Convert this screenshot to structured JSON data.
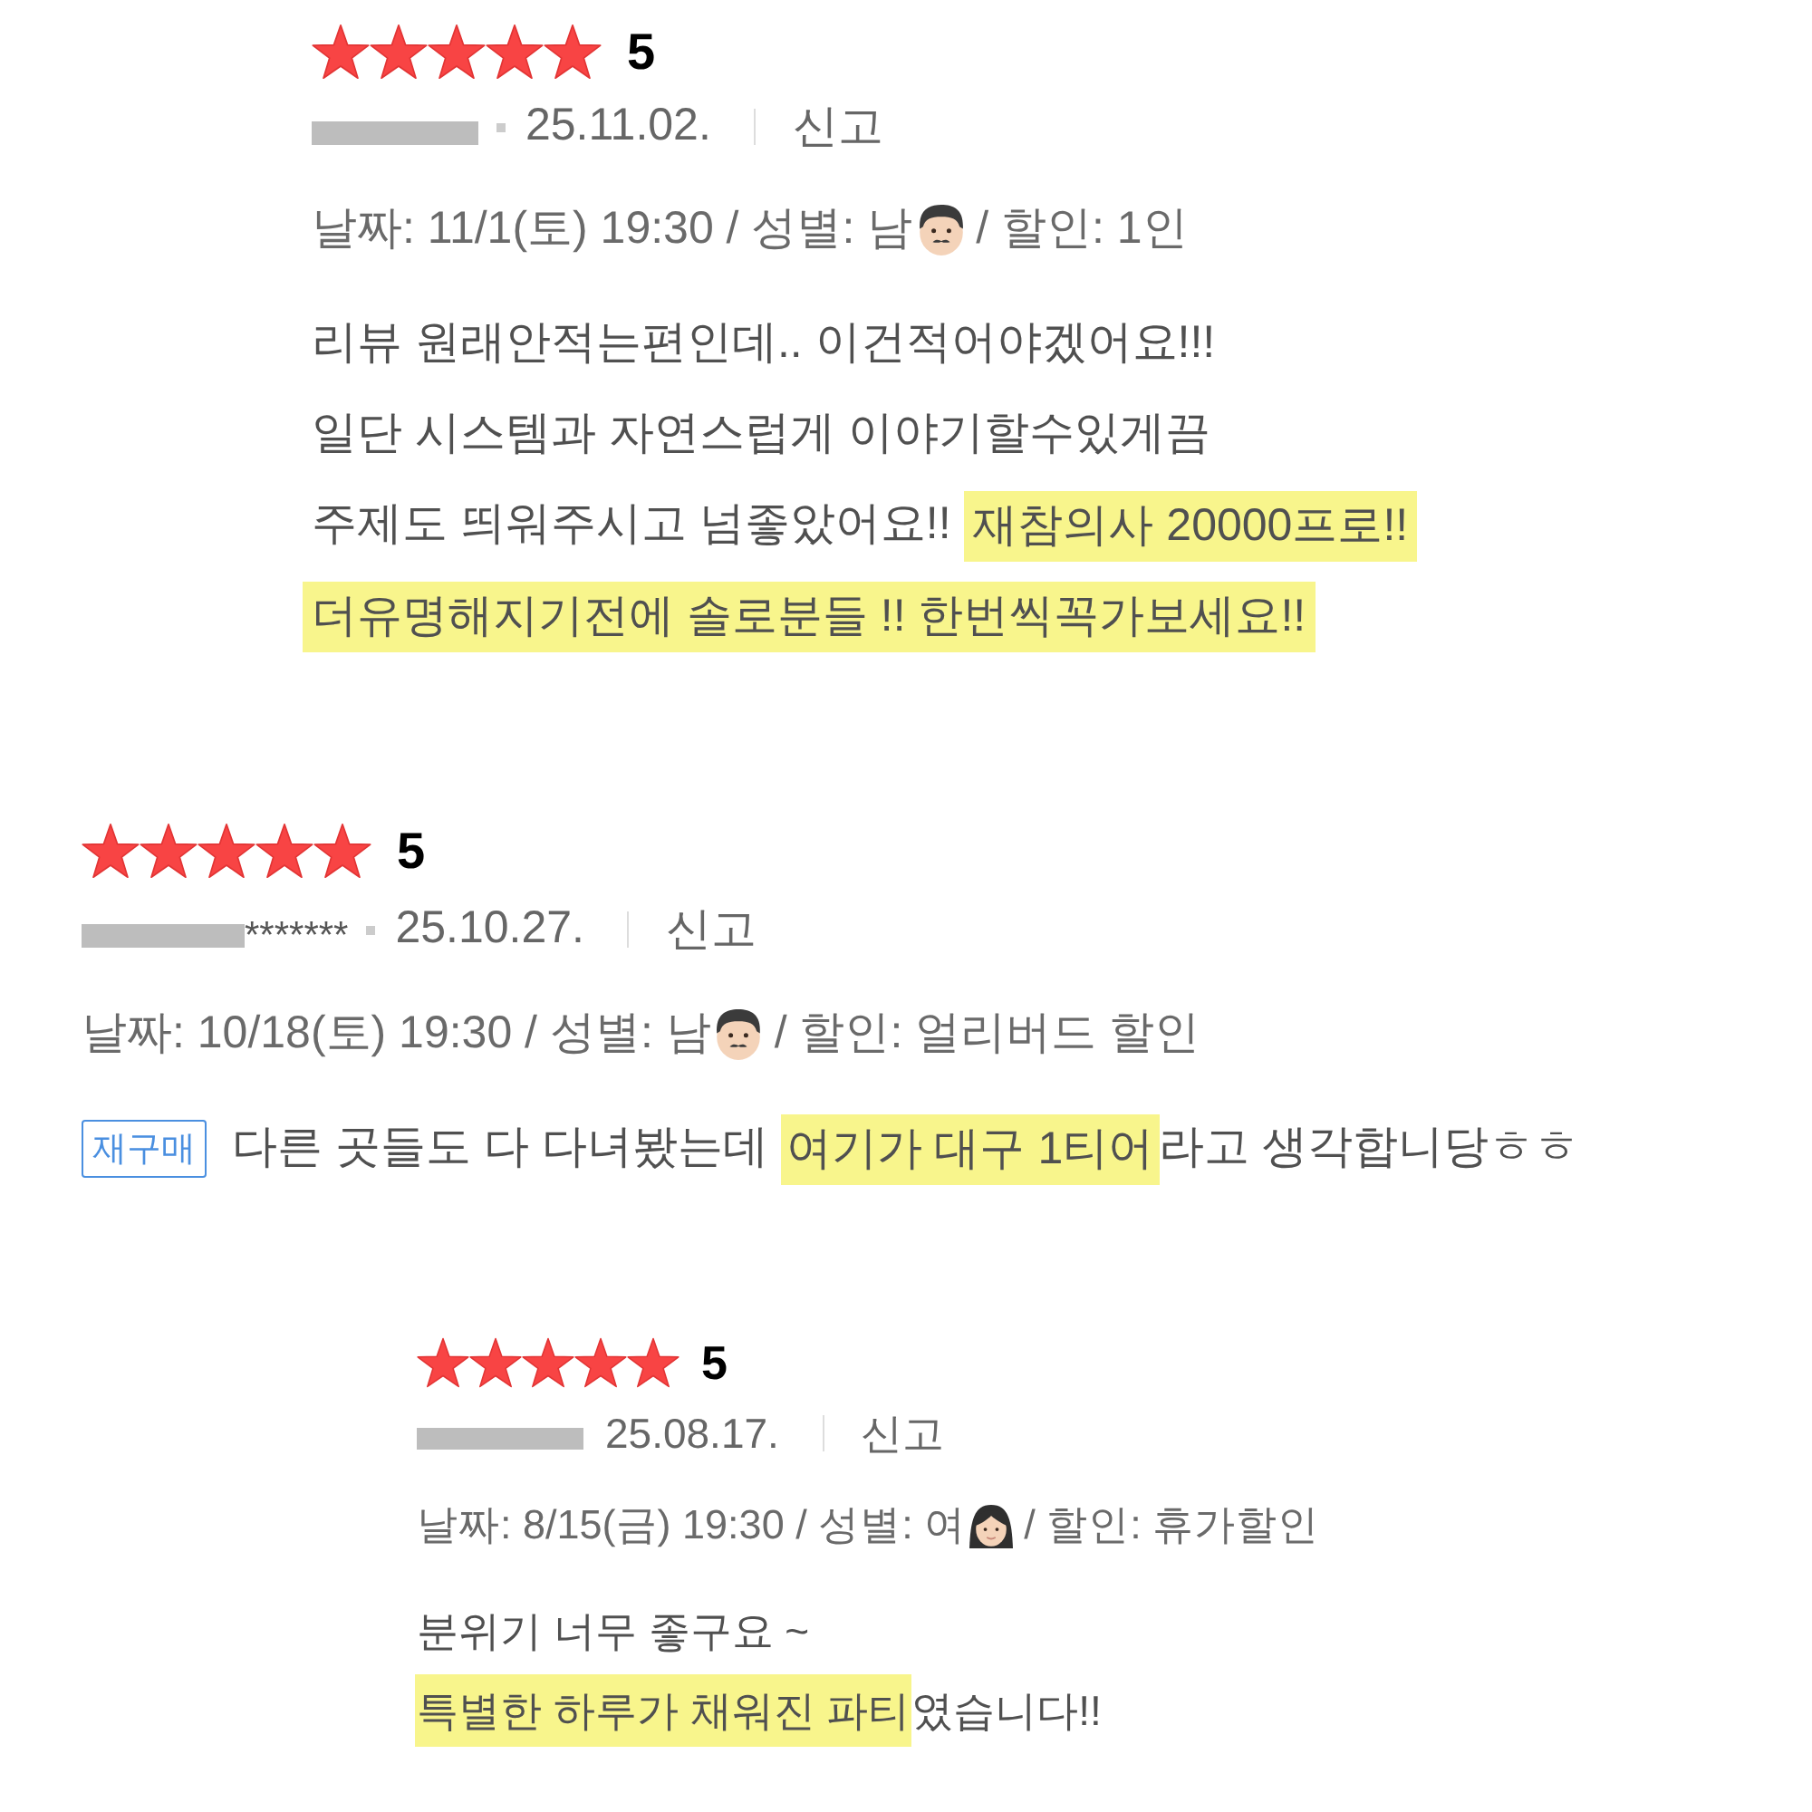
{
  "reviews": [
    {
      "stars": 5,
      "score": "5",
      "author_redacted": true,
      "separator_dot": true,
      "date": "25.11.02.",
      "report": "신고",
      "details": [
        {
          "kind": "text",
          "text": "날짜: 11/1(토) 19:30 / 성별: 남"
        },
        {
          "kind": "man"
        },
        {
          "kind": "text",
          "text": "/ 할인: 1인"
        }
      ],
      "lines": [
        {
          "segments": [
            {
              "text": "리뷰 원래안적는편인데.. 이건적어야겠어요!!!",
              "highlighted": false
            }
          ]
        },
        {
          "segments": [
            {
              "text": "일단 시스템과 자연스럽게 이야기할수있게끔",
              "highlighted": false
            }
          ]
        },
        {
          "segments": [
            {
              "text": "주제도 띄워주시고 넘좋았어요!! ",
              "highlighted": false
            },
            {
              "text": "재참의사 20000프로!!",
              "highlighted": true
            }
          ]
        },
        {
          "segments": [
            {
              "text": "더유명해지기전에 솔로분들 !! 한번씩꼭가보세요!!",
              "highlighted": true
            }
          ]
        }
      ]
    },
    {
      "stars": 5,
      "score": "5",
      "author_redacted": true,
      "author": "*******",
      "separator_dot": true,
      "date": "25.10.27.",
      "report": "신고",
      "details": [
        {
          "kind": "text",
          "text": "날짜: 10/18(토) 19:30 / 성별: 남"
        },
        {
          "kind": "man"
        },
        {
          "kind": "text",
          "text": "/ 할인: 얼리버드 할인"
        }
      ],
      "badge": "재구매",
      "lines": [
        {
          "segments": [
            {
              "text": "다른 곳들도 다 다녀봤는데 ",
              "highlighted": false
            },
            {
              "text": "여기가 대구 1티어",
              "highlighted": true
            },
            {
              "text": "라고 생각합니당ㅎㅎ",
              "highlighted": false
            }
          ]
        }
      ]
    },
    {
      "stars": 5,
      "score": "5",
      "author_redacted": true,
      "separator_dot": false,
      "date": "25.08.17.",
      "report": "신고",
      "details": [
        {
          "kind": "text",
          "text": "날짜: 8/15(금) 19:30 / 성별: 여"
        },
        {
          "kind": "woman"
        },
        {
          "kind": "text",
          "text": "/ 할인: 휴가할인"
        }
      ],
      "lines": [
        {
          "segments": [
            {
              "text": "분위기 너무 좋구요 ~",
              "highlighted": false
            }
          ]
        },
        {
          "segments": [
            {
              "text": "특별한 하루가 채워진 파티",
              "highlighted": true
            },
            {
              "text": "였습니다!!",
              "highlighted": false
            }
          ]
        }
      ]
    }
  ]
}
